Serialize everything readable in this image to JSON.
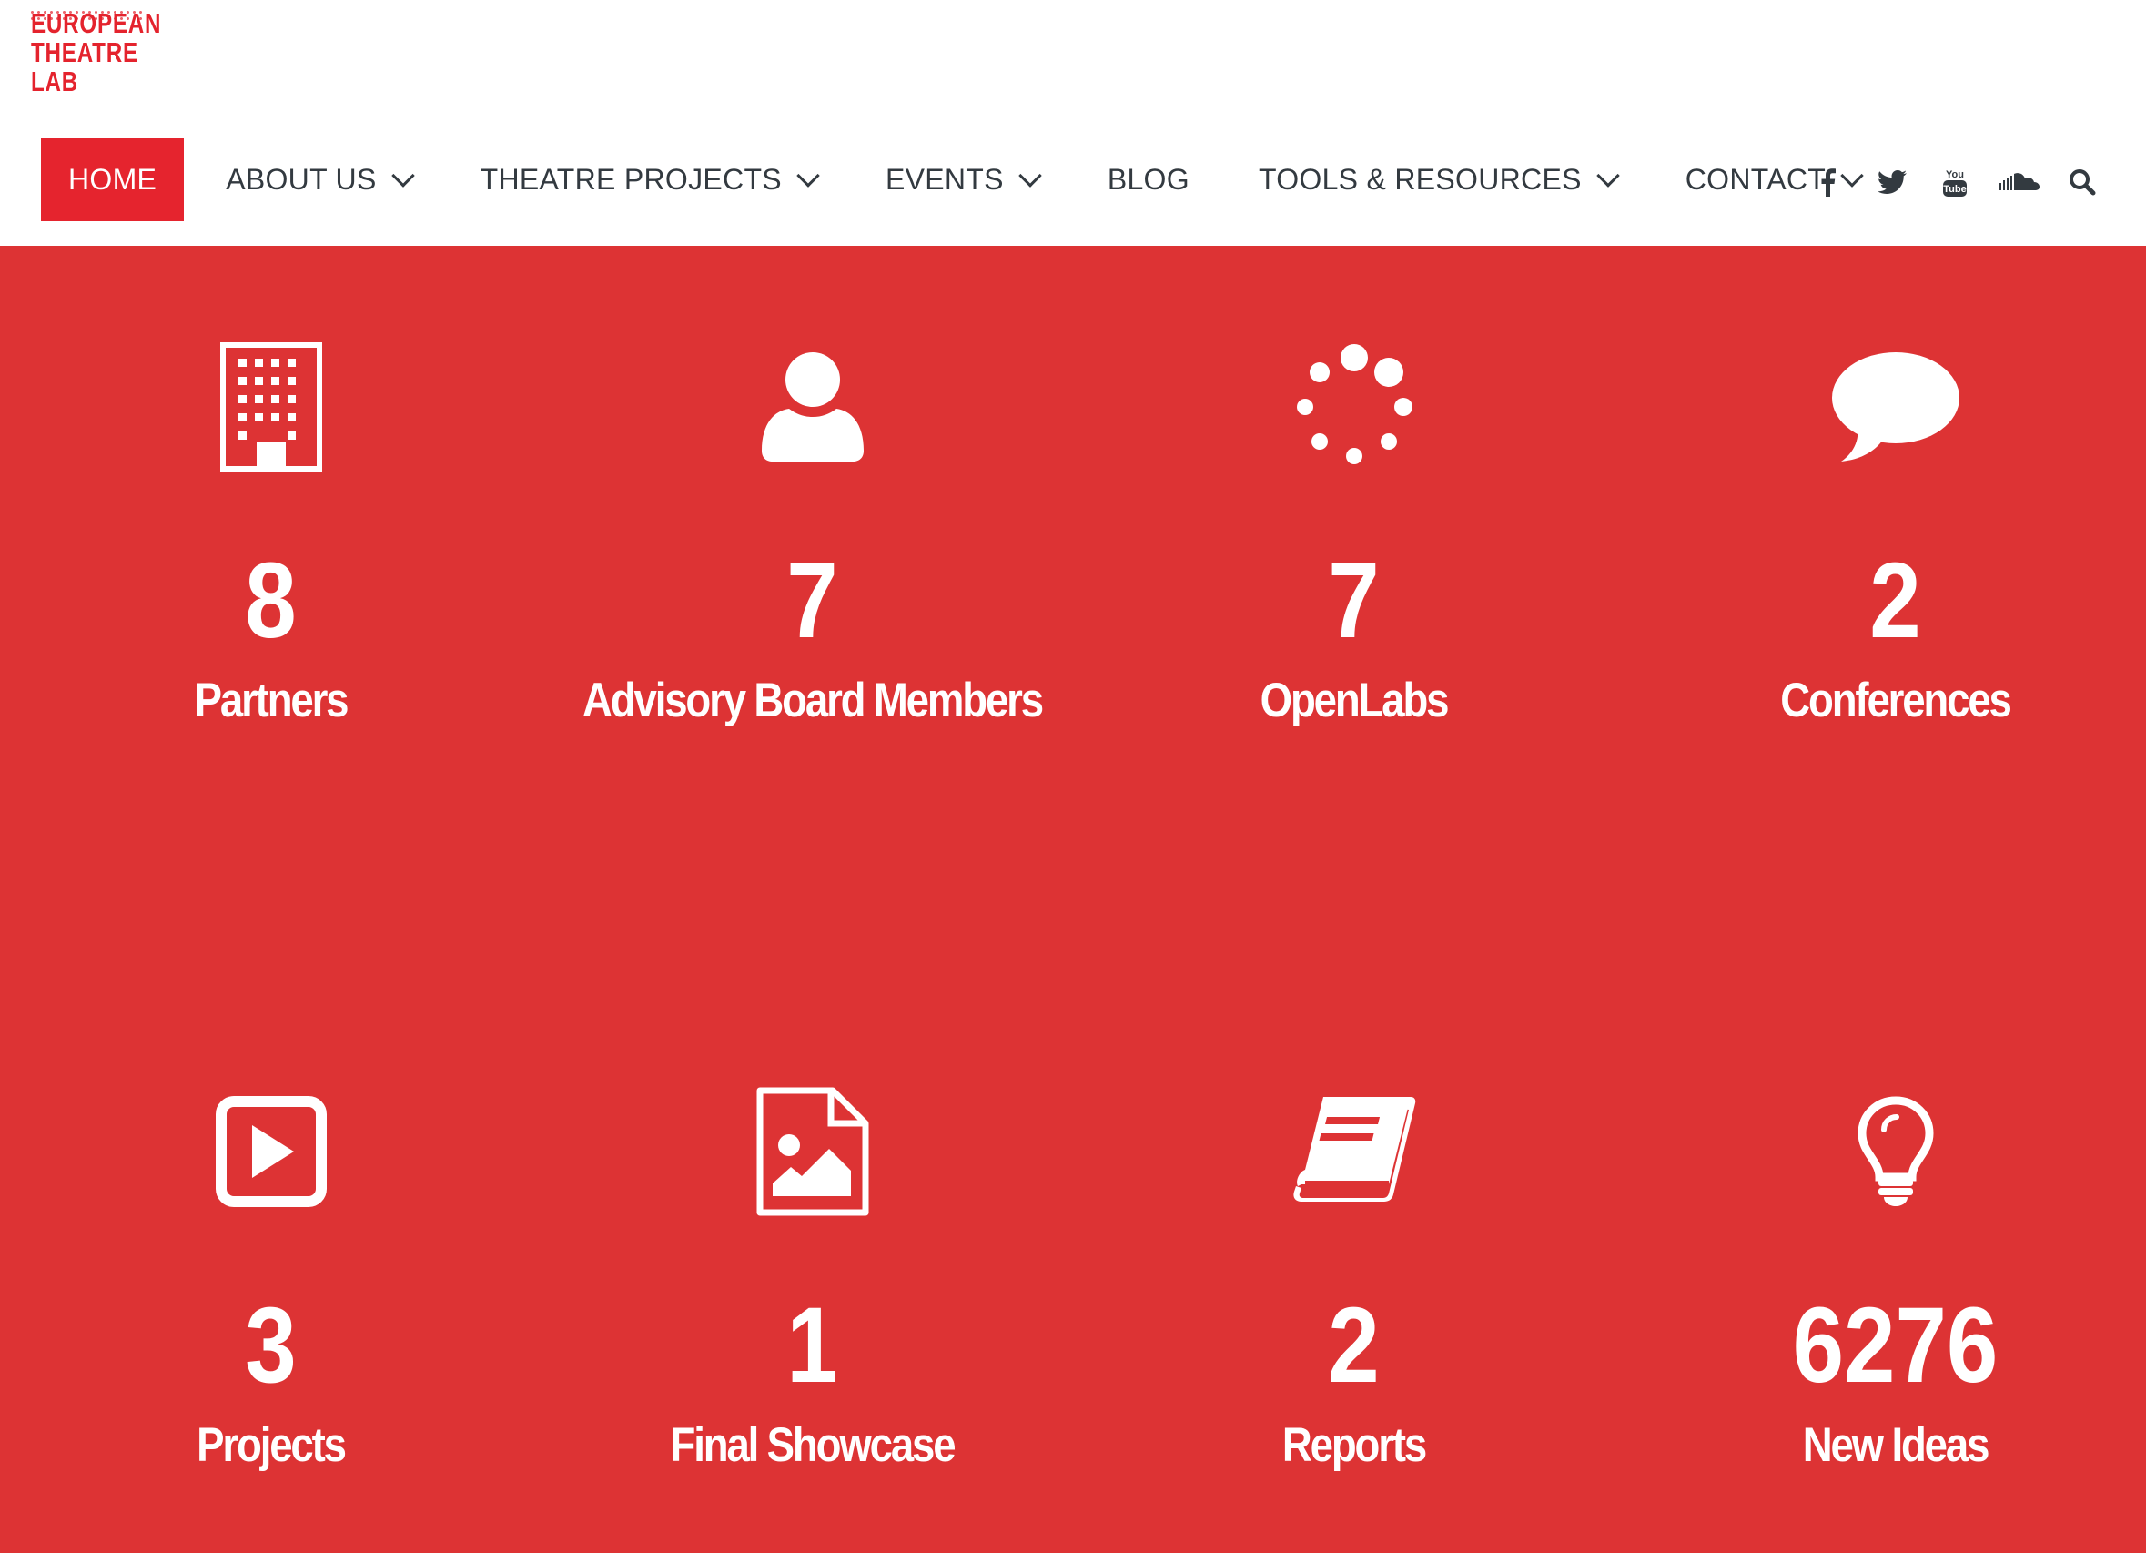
{
  "logo": {
    "lines": [
      "EUROPEAN",
      "THEATRE",
      "LAB"
    ]
  },
  "nav": {
    "items": [
      {
        "label": "HOME",
        "dropdown": false,
        "active": true
      },
      {
        "label": "ABOUT US",
        "dropdown": true
      },
      {
        "label": "THEATRE PROJECTS",
        "dropdown": true
      },
      {
        "label": "EVENTS",
        "dropdown": true
      },
      {
        "label": "BLOG",
        "dropdown": false
      },
      {
        "label": "TOOLS & RESOURCES",
        "dropdown": true
      },
      {
        "label": "CONTACT",
        "dropdown": true
      }
    ]
  },
  "social": [
    {
      "icon": "facebook-icon"
    },
    {
      "icon": "twitter-icon"
    },
    {
      "icon": "youtube-icon"
    },
    {
      "icon": "soundcloud-icon"
    },
    {
      "icon": "search-icon"
    }
  ],
  "colors": {
    "accent": "#e5242e",
    "stats_background": "#dd3334",
    "nav_text": "#333a40"
  },
  "stats": [
    {
      "icon": "building-icon",
      "value": "8",
      "label": "Partners"
    },
    {
      "icon": "user-icon",
      "value": "7",
      "label": "Advisory Board Members"
    },
    {
      "icon": "spinner-icon",
      "value": "7",
      "label": "OpenLabs"
    },
    {
      "icon": "speech-bubble-icon",
      "value": "2",
      "label": "Conferences"
    },
    {
      "icon": "play-icon",
      "value": "3",
      "label": "Projects"
    },
    {
      "icon": "image-file-icon",
      "value": "1",
      "label": "Final Showcase"
    },
    {
      "icon": "book-icon",
      "value": "2",
      "label": "Reports"
    },
    {
      "icon": "lightbulb-icon",
      "value": "6276",
      "label": "New Ideas"
    }
  ]
}
